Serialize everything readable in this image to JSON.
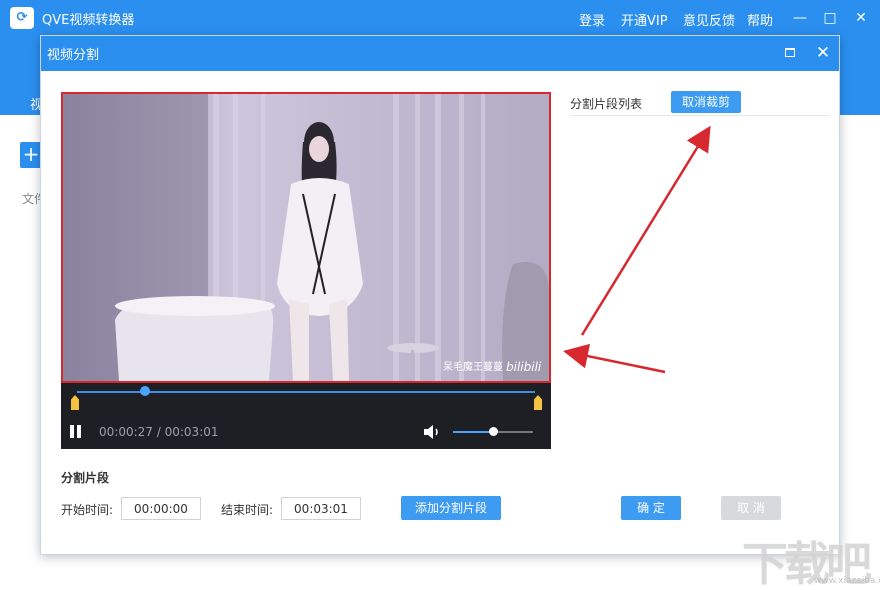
{
  "app": {
    "title": "QVE视频转换器",
    "logo_icon": "video-convert-icon",
    "menu": [
      "登录",
      "开通VIP",
      "意见反馈",
      "帮助"
    ],
    "tab_fragment": "视",
    "file_fragment": "文件",
    "add_symbol": "+"
  },
  "dialog": {
    "title": "视频分割",
    "close_symbol": "✕"
  },
  "video": {
    "watermark_user": "呆毛魔王蔓蔓",
    "watermark_brand": "bilibili",
    "current_time": "00:00:27",
    "separator": "/",
    "total_time": "00:03:01",
    "progress_fraction": 0.149,
    "volume_fraction": 0.5
  },
  "segment_list": {
    "label": "分割片段列表",
    "cancel_crop": "取消裁剪"
  },
  "segment_form": {
    "heading": "分割片段",
    "start_label": "开始时间:",
    "start_value": "00:00:00",
    "end_label": "结束时间:",
    "end_value": "00:03:01",
    "add_button": "添加分割片段",
    "confirm_button": "确 定",
    "cancel_button": "取 消"
  },
  "site_watermark": {
    "text": "下载吧",
    "url": "www.xiazaiba.com"
  },
  "colors": {
    "brand_blue": "#2b8ff0",
    "button_blue": "#3d9bf2",
    "highlight_red": "#d6282e",
    "marker_yellow": "#f5c242"
  }
}
